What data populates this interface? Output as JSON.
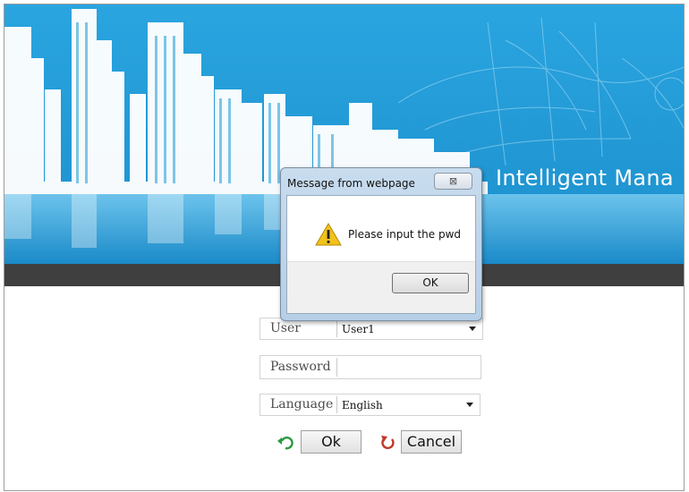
{
  "app": {
    "title": "Intelligent Mana"
  },
  "login": {
    "user_label": "User",
    "user_value": "User1",
    "password_label": "Password",
    "password_value": "",
    "language_label": "Language",
    "language_value": "English",
    "ok_label": "Ok",
    "cancel_label": "Cancel"
  },
  "dialog": {
    "title": "Message from webpage",
    "close_glyph": "⊠",
    "message": "Please input the pwd",
    "ok_label": "OK"
  },
  "colors": {
    "banner_blue": "#1a9ad6",
    "dark_bar": "#3f3f3f",
    "ok_icon": "#2a9a3f",
    "cancel_icon": "#c0392b",
    "warning": "#f2c21b"
  },
  "icons": {
    "ok": "refresh-arrow-icon",
    "cancel": "undo-icon",
    "warning": "warning-icon",
    "close": "close-icon",
    "dropdown": "chevron-down-icon"
  }
}
